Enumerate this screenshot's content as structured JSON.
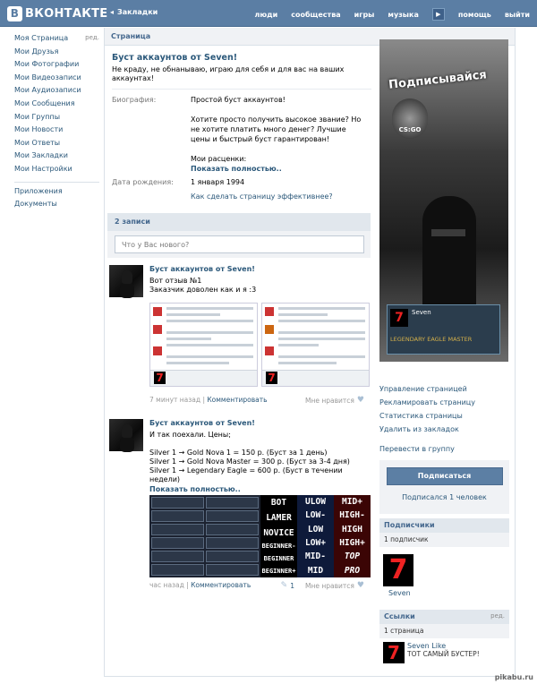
{
  "header": {
    "logo": "ВКОНТАКТЕ",
    "logo_letter": "В",
    "bookmarks_arrow": "◂",
    "bookmarks": "Закладки",
    "nav": [
      "люди",
      "сообщества",
      "игры",
      "музыка",
      "помощь",
      "выйти"
    ],
    "play_glyph": "▶"
  },
  "sidebar": {
    "edit_label": "ред.",
    "items": [
      "Моя Страница",
      "Мои Друзья",
      "Мои Фотографии",
      "Мои Видеозаписи",
      "Мои Аудиозаписи",
      "Мои Сообщения",
      "Мои Группы",
      "Мои Новости",
      "Мои Ответы",
      "Мои Закладки",
      "Мои Настройки"
    ],
    "extra": [
      "Приложения",
      "Документы"
    ]
  },
  "panel_title": "Страница",
  "page": {
    "name": "Буст аккаунтов от Seven!",
    "status": "Не краду, не обнанываю, играю для себя и для вас на ваших аккаунтах!",
    "bio_label": "Биография:",
    "bio_lines": [
      "Простой буст аккаунтов!",
      "",
      "Хотите просто получить высокое звание? Но не хотите платить много денег? Лучшие цены и быстрый буст гарантирован!",
      "",
      "Мои расценки:"
    ],
    "show_full": "Показать полностью..",
    "birth_label": "Дата рождения:",
    "birth_value": "1 января 1994",
    "howto": "Как сделать страницу эффективнее?"
  },
  "wall": {
    "count": "2 записи",
    "placeholder": "Что у Вас нового?"
  },
  "posts": [
    {
      "author": "Буст аккаунтов от Seven!",
      "text": "Вот отзыв №1\nЗаказчик доволен как и я :3",
      "time": "7 минут назад",
      "comment": "Комментировать",
      "like": "Мне нравится",
      "like_count": ""
    },
    {
      "author": "Буст аккаунтов от Seven!",
      "text": "И так поехали. Цены;\n\nSilver 1 → Gold Nova 1 = 150 р. (Буст за 1 день)\nSilver 1 → Gold Nova Master = 300 р. (Буст за 3-4 дня)\nSilver 1 → Legendary Eagle = 600 р. (Буст в течении недели)",
      "show_full": "Показать полностью..",
      "time": "час назад",
      "comment": "Комментировать",
      "like": "Мне нравится",
      "like_count": "1"
    }
  ],
  "shot_digit": "7",
  "price_image": {
    "col1": [
      "BOT",
      "LAMER",
      "NOVICE",
      "BEGINNER-",
      "BEGINNER",
      "BEGINNER+"
    ],
    "col2": [
      "ULOW",
      "LOW-",
      "LOW",
      "LOW+",
      "MID-",
      "MID"
    ],
    "col3": [
      "MID+",
      "HIGH-",
      "HIGH",
      "HIGH+",
      "TOP",
      "PRO"
    ]
  },
  "banner": {
    "title": "Подписывайся",
    "game": "CS:GO",
    "card_digit": "7",
    "card_name": "Seven",
    "card_rank": "LEGENDARY EAGLE MASTER"
  },
  "manage": [
    "Управление страницей",
    "Рекламировать страницу",
    "Статистика страницы",
    "Удалить из закладок"
  ],
  "move_to_group": "Перевести в группу",
  "subscribe": {
    "button": "Подписаться",
    "count": "Подписался 1 человек"
  },
  "followers": {
    "title": "Подписчики",
    "count": "1 подписчик",
    "avatar_digit": "7",
    "name": "Seven"
  },
  "links": {
    "title": "Ссылки",
    "edit": "ред.",
    "count": "1 страница",
    "avatar_digit": "7",
    "name": "Seven Like",
    "desc": "ТОТ САМЫЙ БУСТЕР!"
  },
  "watermark": "pikabu.ru"
}
